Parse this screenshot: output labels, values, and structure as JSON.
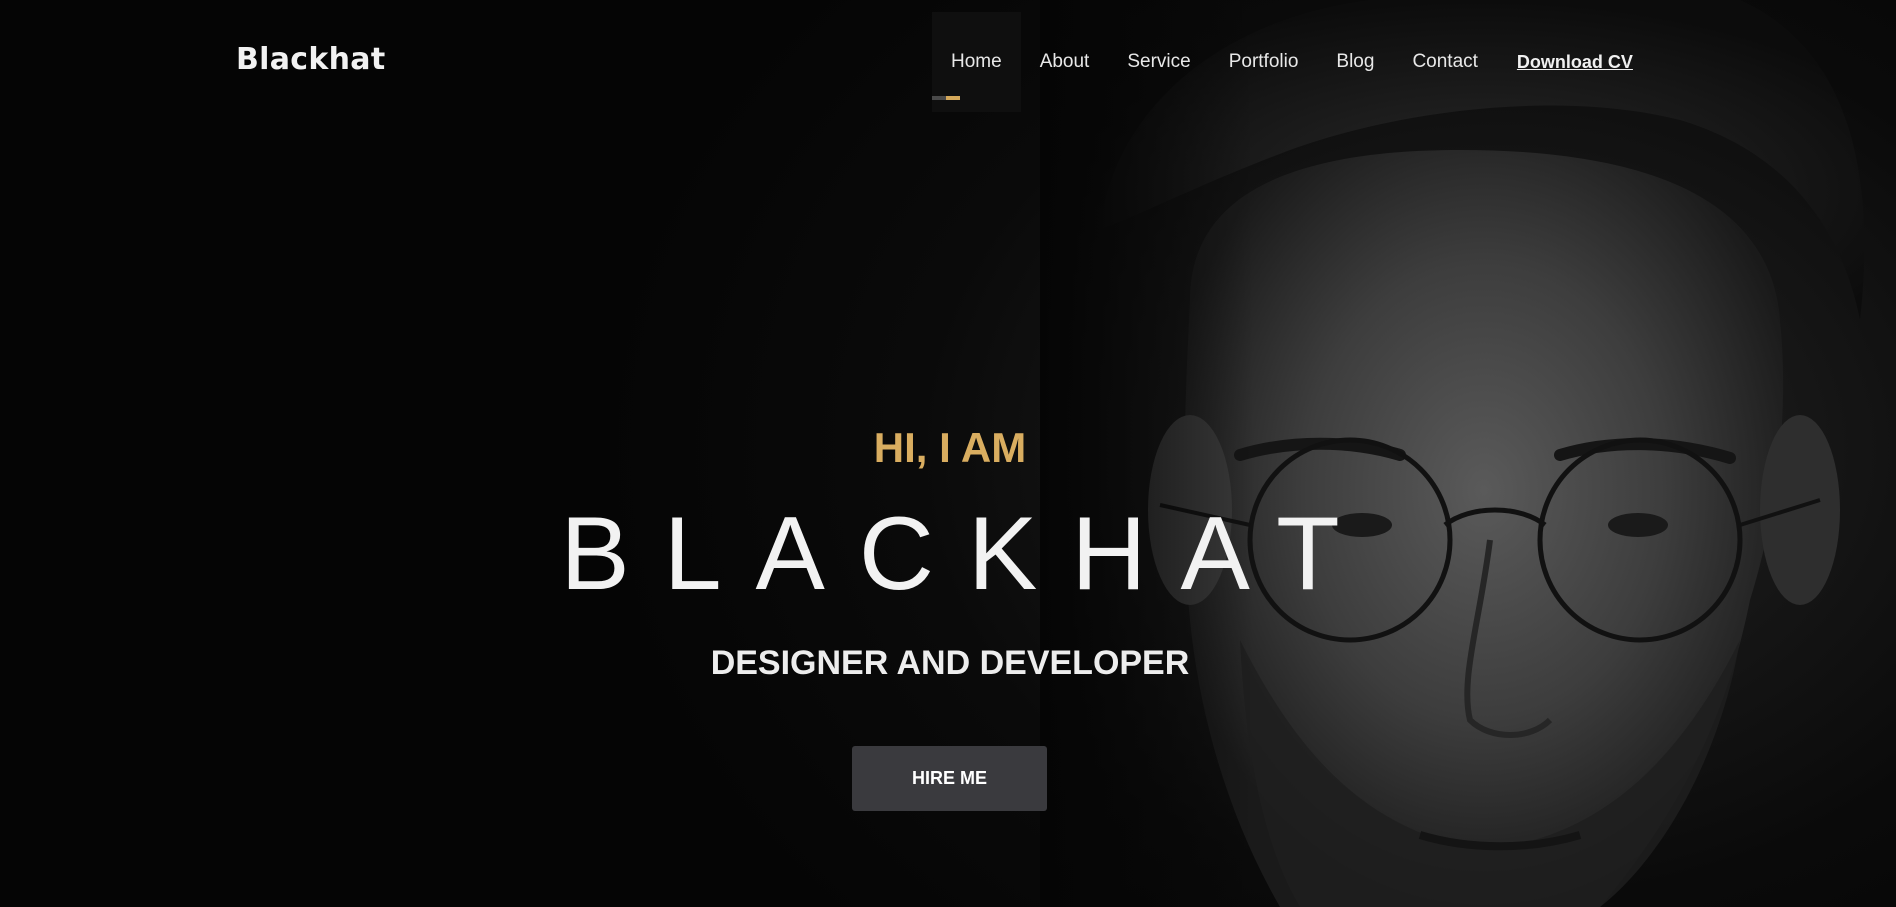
{
  "header": {
    "logo": "Blackhat",
    "nav": [
      {
        "label": "Home",
        "active": true
      },
      {
        "label": "About"
      },
      {
        "label": "Service"
      },
      {
        "label": "Portfolio"
      },
      {
        "label": "Blog"
      },
      {
        "label": "Contact"
      }
    ],
    "cv_link": "Download CV"
  },
  "hero": {
    "intro": "HI, I AM",
    "name": "BLACKHAT",
    "role": "DESIGNER AND DEVELOPER",
    "cta": "HIRE ME",
    "portrait_alt": "black-and-white portrait photo"
  },
  "colors": {
    "background": "#050505",
    "accent_gold": "#d9ad60",
    "button": "#3a3a3e",
    "text": "#f2f2f2"
  }
}
